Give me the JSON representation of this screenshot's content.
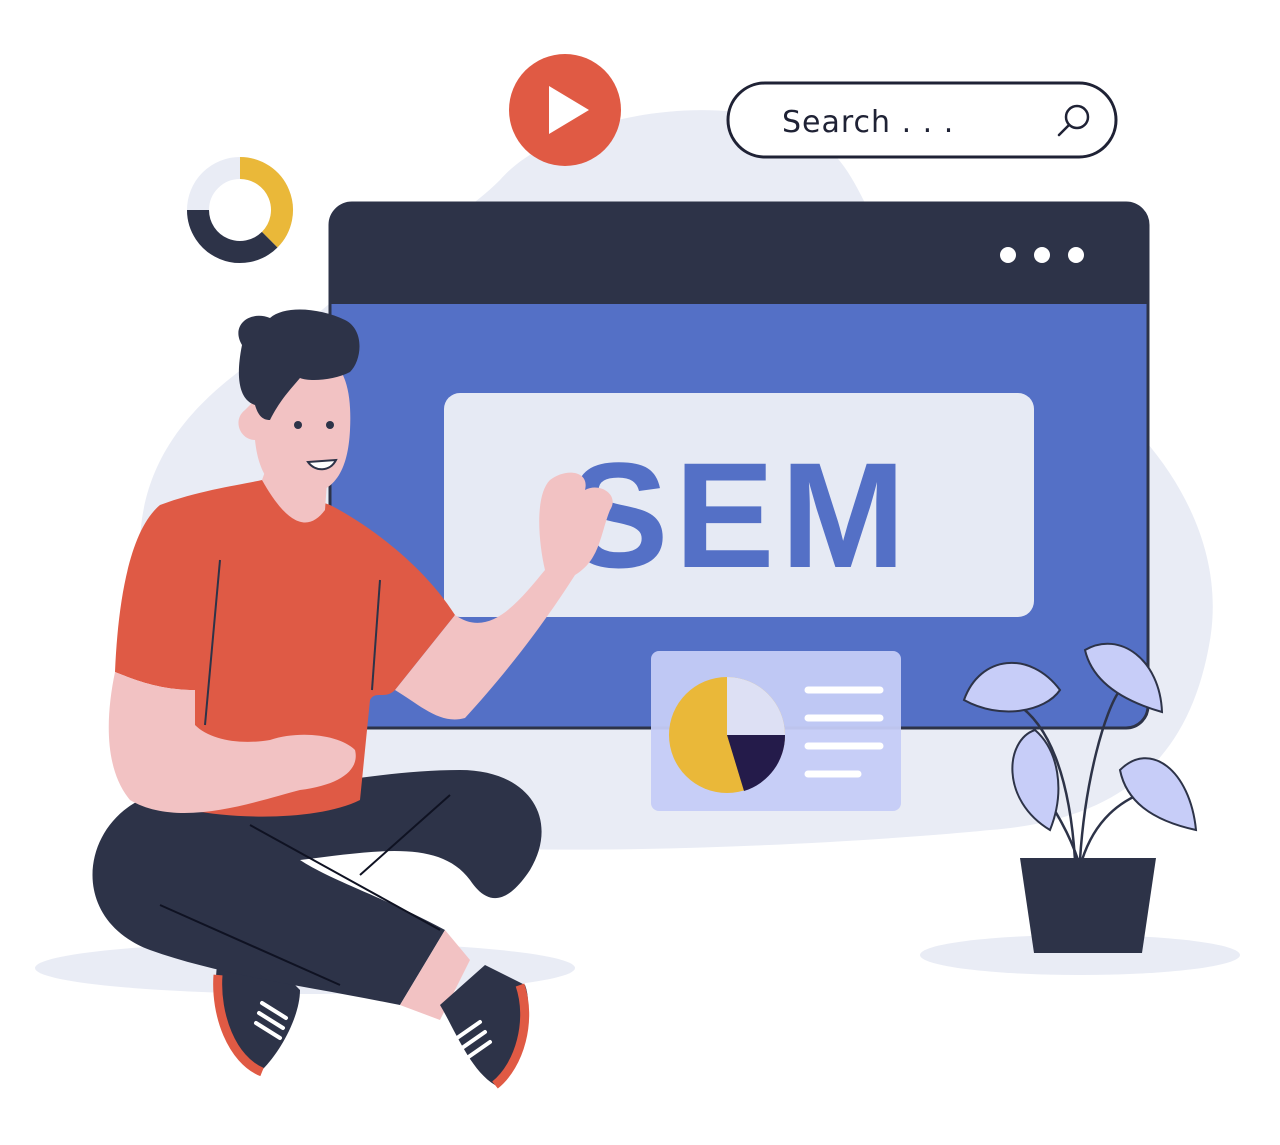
{
  "search": {
    "placeholder": "Search . . ."
  },
  "window": {
    "heading": "SEM"
  },
  "colors": {
    "accent_blue": "#5470c6",
    "dark_navy": "#2d3348",
    "panel_light": "#e6eaf4",
    "play_red": "#e05a44",
    "shirt_red": "#df5a45",
    "gold": "#eab839",
    "plant_leaf": "#c7cdf8",
    "background_blob": "#e9ecf5",
    "skin": "#f2c2c3"
  },
  "icons": [
    "play-icon",
    "search-icon",
    "donut-chart-icon",
    "pie-chart-icon",
    "window-dots-icon"
  ]
}
